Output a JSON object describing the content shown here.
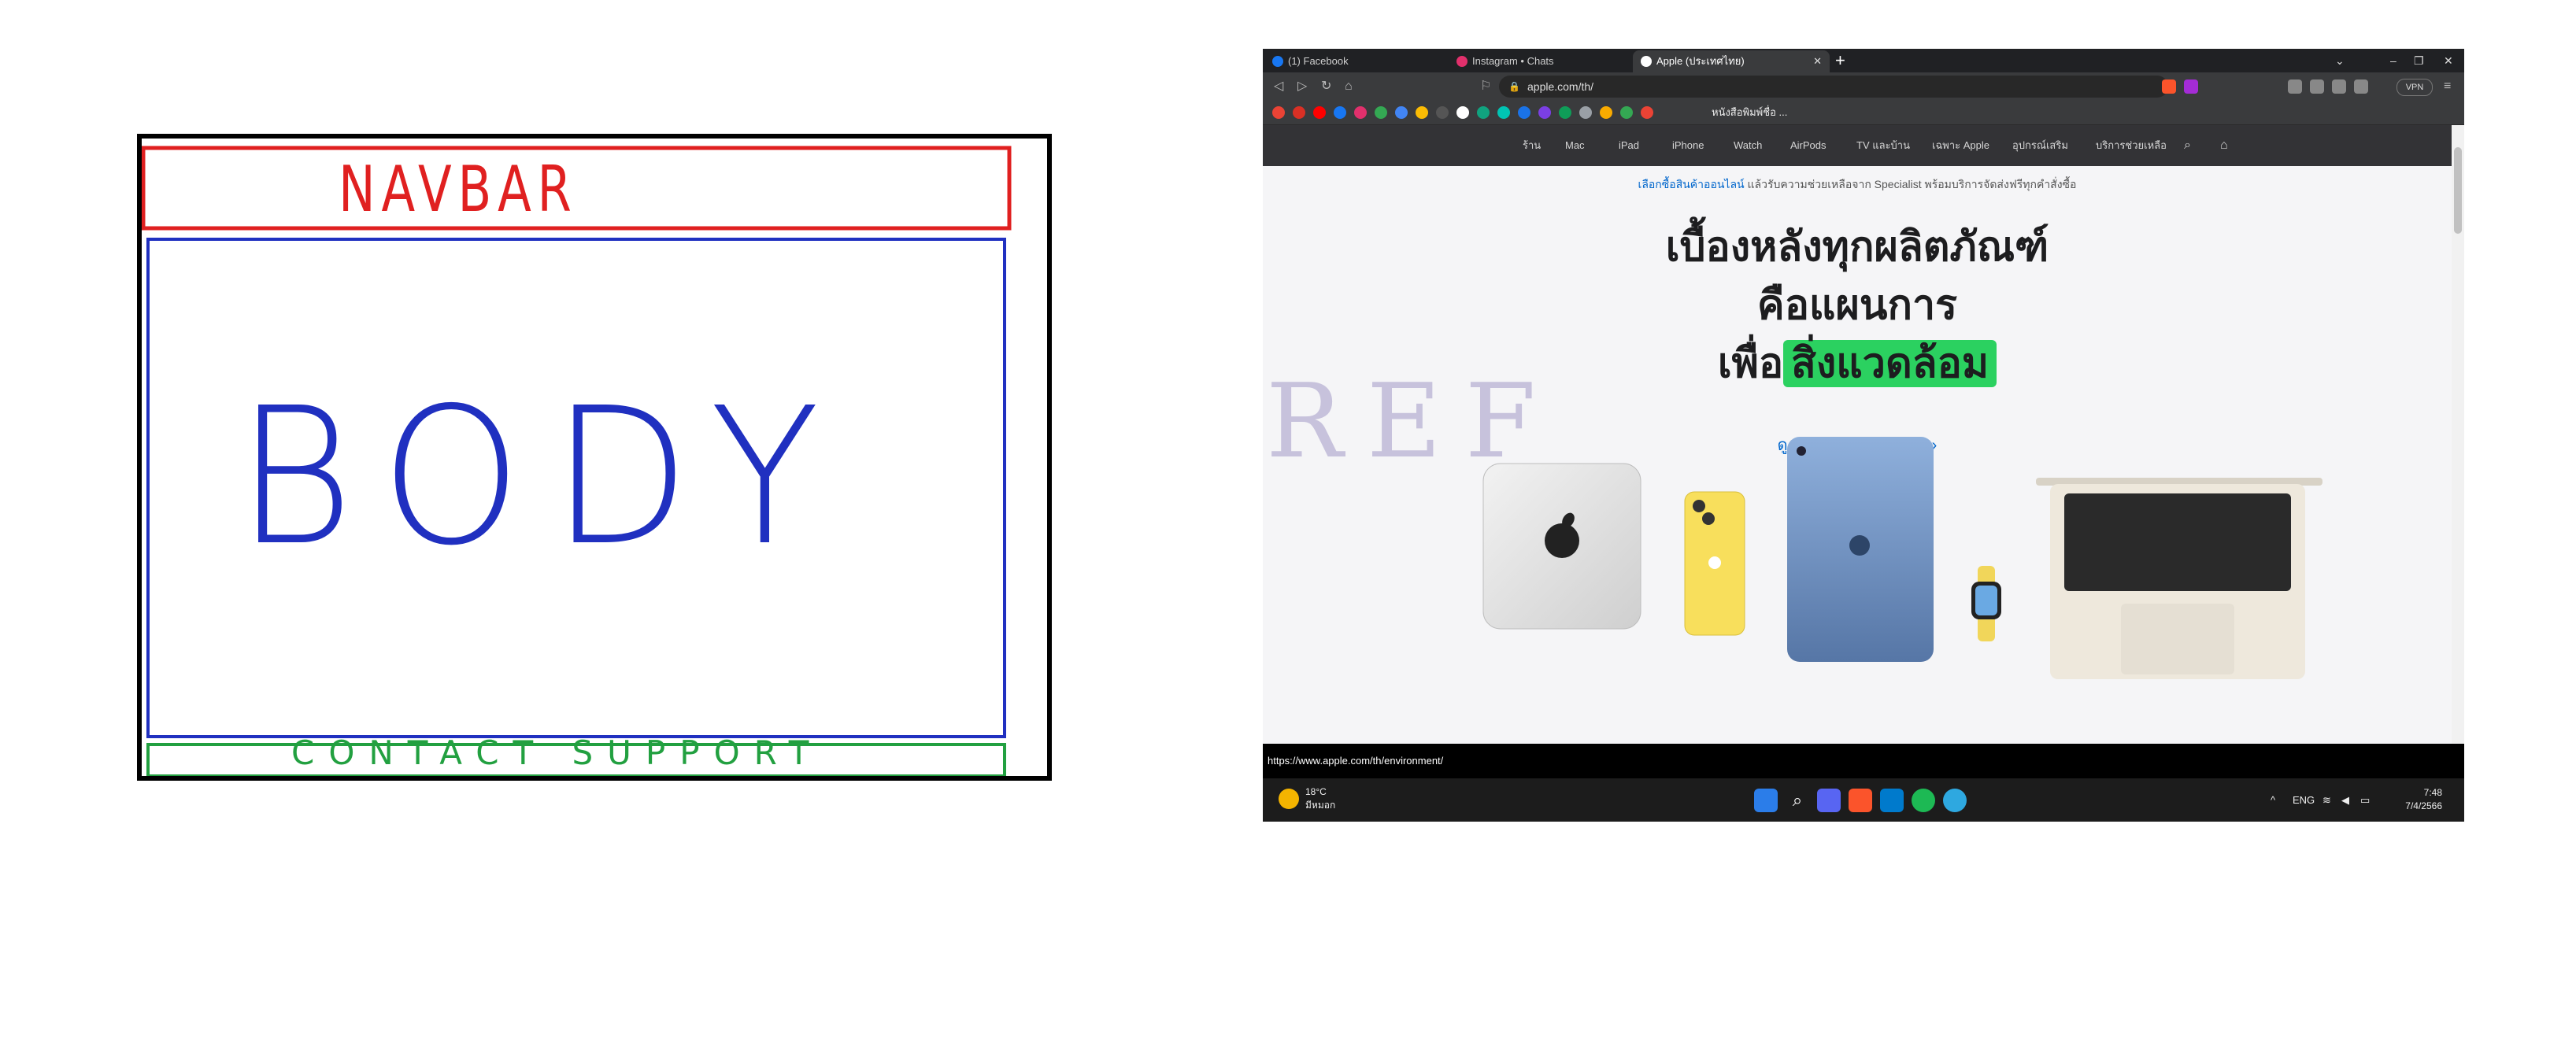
{
  "sketch": {
    "navbar_label": "NAVBAR",
    "body_label": "BODY",
    "footer_label": "CONTACT   SUPPORT",
    "colors": {
      "navbar": "#e02020",
      "body": "#2030c0",
      "footer": "#22a040"
    }
  },
  "browser": {
    "tabs": [
      {
        "label": "(1) Facebook",
        "favicon_color": "#1877f2"
      },
      {
        "label": "Instagram • Chats",
        "favicon_color": "#e1306c"
      },
      {
        "label": "Apple (ประเทศไทย)",
        "favicon_color": "#ffffff"
      }
    ],
    "new_tab_symbol": "+",
    "window_controls": {
      "chevron": "⌄",
      "minimize": "–",
      "maximize": "❐",
      "close": "✕"
    },
    "url": "apple.com/th/",
    "vpn_label": "VPN",
    "bookmark_label": "หนังสือพิมพ์ชื่อ ...",
    "status_url": "https://www.apple.com/th/environment/"
  },
  "apple_nav": {
    "items": [
      "ร้าน",
      "Mac",
      "iPad",
      "iPhone",
      "Watch",
      "AirPods",
      "TV และบ้าน",
      "เฉพาะ Apple",
      "อุปกรณ์เสริม",
      "บริการช่วยเหลือ"
    ]
  },
  "ribbon": {
    "link": "เลือกซื้อสินค้าออนไลน์",
    "text": " แล้วรับความช่วยเหลือจาก Specialist พร้อมบริการจัดส่งฟรีทุกคำสั่งซื้อ"
  },
  "hero": {
    "line1": "เบื้องหลังทุกผลิตภัณฑ์",
    "line2": "คือแผนการ",
    "line3_prefix": "เพื่อ",
    "line3_highlight": "สิ่งแวดล้อม",
    "link": "ดูความคืบหน้าของเรา ›",
    "highlight_color": "#2bd160"
  },
  "overlay_label": "REF",
  "taskbar": {
    "weather_temp": "18°C",
    "weather_desc": "มีหมอก",
    "lang": "ENG",
    "time": "7:48",
    "date": "7/4/2566"
  }
}
